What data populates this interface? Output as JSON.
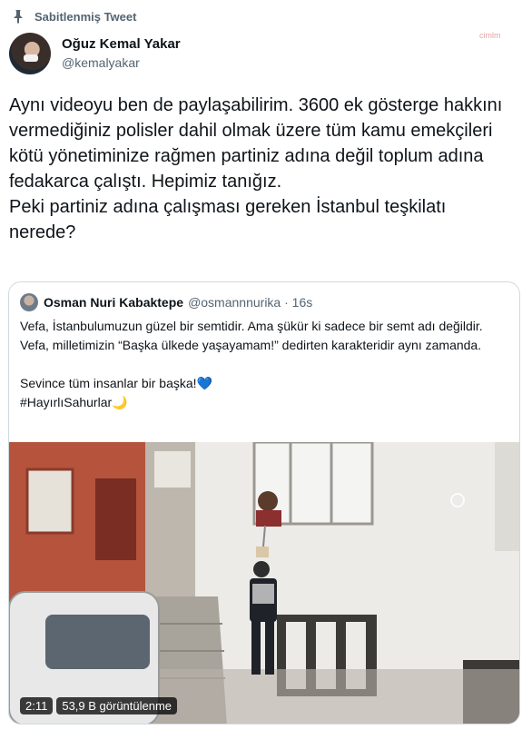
{
  "pinned": {
    "label": "Sabitlenmiş Tweet",
    "icon": "pin-icon"
  },
  "author": {
    "display_name": "Oğuz Kemal Yakar",
    "handle": "@kemalyakar"
  },
  "tweet": {
    "text": "Aynı videoyu ben de paylaşabilirim. 3600 ek gösterge hakkını vermediğiniz polisler dahil olmak üzere tüm kamu emekçileri kötü yönetiminize rağmen partiniz adına değil toplum adına fedakarca çalıştı. Hepimiz tanığız.\nPeki partiniz adına çalışması gereken İstanbul teşkilatı nerede?"
  },
  "quote": {
    "display_name": "Osman Nuri Kabaktepe",
    "meta": "@osmannnurika · 16s",
    "line1": "Vefa, İstanbulumuzun güzel bir semtidir. Ama şükür ki sadece bir semt adı değildir. Vefa, milletimizin “Başka ülkede yaşayamam!” dedirten karakteridir aynı zamanda.",
    "line2": "Sevince tüm insanlar bir başka!",
    "line2_emoji": "💙",
    "line3": "#HayırlıSahurlar",
    "line3_emoji": "🌙",
    "video": {
      "duration": "2:11",
      "views": "53,9 B görüntülenme"
    }
  },
  "watermark": "cimlm"
}
